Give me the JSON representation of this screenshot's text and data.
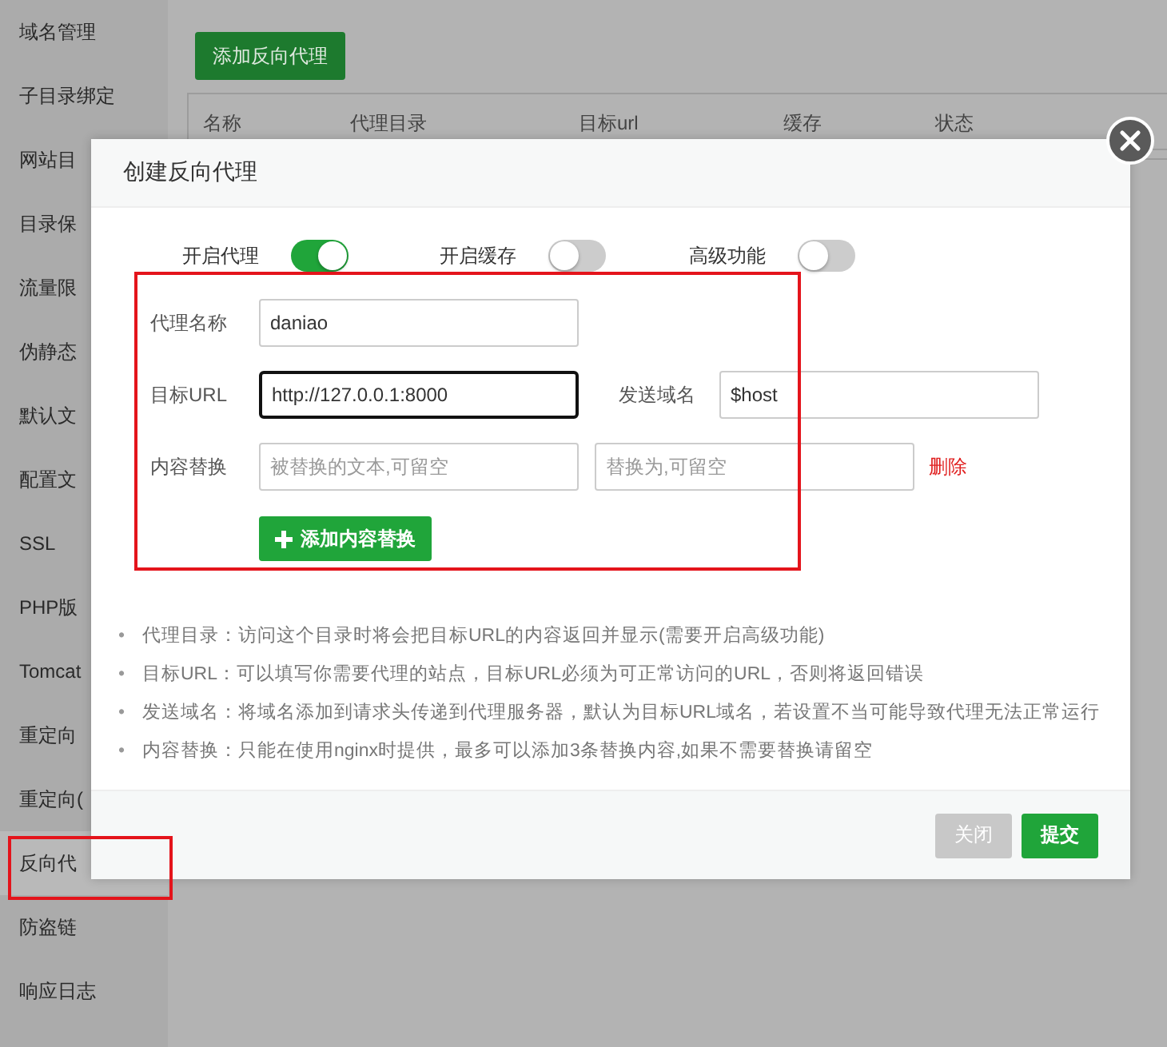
{
  "sidebar": {
    "items": [
      {
        "label": "域名管理",
        "selected": false
      },
      {
        "label": "子目录绑定",
        "selected": false
      },
      {
        "label": "网站目",
        "selected": false
      },
      {
        "label": "目录保",
        "selected": false
      },
      {
        "label": "流量限",
        "selected": false
      },
      {
        "label": "伪静态",
        "selected": false
      },
      {
        "label": "默认文",
        "selected": false
      },
      {
        "label": "配置文",
        "selected": false
      },
      {
        "label": "SSL",
        "selected": false
      },
      {
        "label": "PHP版",
        "selected": false
      },
      {
        "label": "Tomcat",
        "selected": false
      },
      {
        "label": "重定向",
        "selected": false
      },
      {
        "label": "重定向(",
        "selected": false
      },
      {
        "label": "反向代",
        "selected": true
      },
      {
        "label": "防盗链",
        "selected": false
      },
      {
        "label": "响应日志",
        "selected": false
      }
    ]
  },
  "toolbar": {
    "add_button": "添加反向代理"
  },
  "table": {
    "columns": [
      "名称",
      "代理目录",
      "目标url",
      "缓存",
      "状态"
    ]
  },
  "dialog": {
    "title": "创建反向代理",
    "toggles": [
      {
        "label": "开启代理",
        "on": true
      },
      {
        "label": "开启缓存",
        "on": false
      },
      {
        "label": "高级功能",
        "on": false
      }
    ],
    "name_field": {
      "label": "代理名称",
      "value": "daniao"
    },
    "target_field": {
      "label": "目标URL",
      "value": "http://127.0.0.1:8000",
      "focused": true
    },
    "send_domain_field": {
      "label": "发送域名",
      "value": "$host"
    },
    "replace_row": {
      "label": "内容替换",
      "find_placeholder": "被替换的文本,可留空",
      "replace_placeholder": "替换为,可留空",
      "delete_link": "删除"
    },
    "add_replace_button": "添加内容替换",
    "notes": [
      {
        "bullet": "•",
        "text": "代理目录：访问这个目录时将会把目标URL的内容返回并显示(需要开启高级功能)"
      },
      {
        "bullet": "•",
        "text": "目标URL：可以填写你需要代理的站点，目标URL必须为可正常访问的URL，否则将返回错误"
      },
      {
        "bullet": "•",
        "text": "发送域名：将域名添加到请求头传递到代理服务器，默认为目标URL域名，若设置不当可能导致代理无法正常运行"
      },
      {
        "bullet": "•",
        "text": "内容替换：只能在使用nginx时提供，最多可以添加3条替换内容,如果不需要替换请留空"
      }
    ],
    "buttons": [
      {
        "label": "关闭",
        "kind": "secondary"
      },
      {
        "label": "提交",
        "kind": "primary"
      }
    ]
  }
}
